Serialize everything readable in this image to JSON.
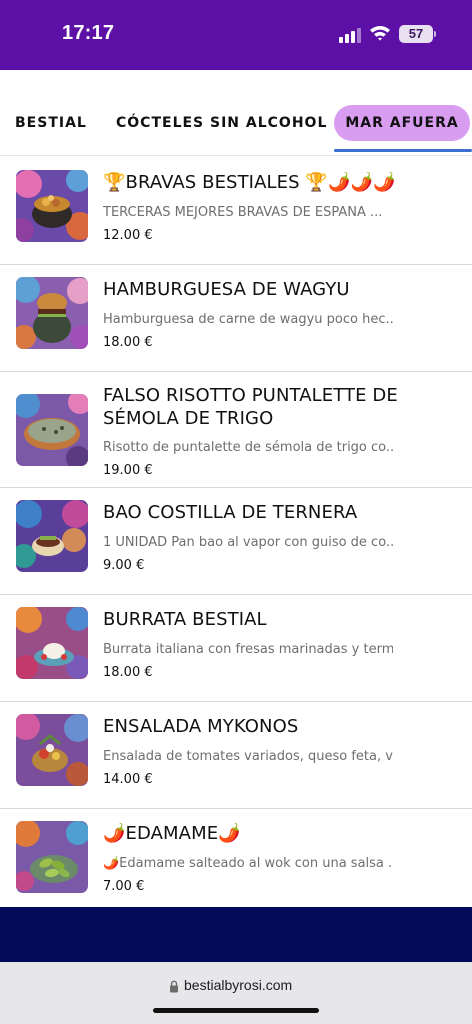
{
  "status_bar": {
    "time": "17:17",
    "battery": "57",
    "background": "#5c10a6"
  },
  "tabs": [
    {
      "label": "BESTIAL",
      "active": false
    },
    {
      "label": "CÓCTELES SIN ALCOHOL",
      "active": false
    },
    {
      "label": "MAR AFUERA",
      "active": true
    }
  ],
  "menu_items": [
    {
      "name": "🏆BRAVAS BESTIALES 🏆🌶️🌶️🌶️",
      "description": "TERCERAS MEJORES BRAVAS DE ESPAÑA ...",
      "price": "12.00 €",
      "image_icon": "bravas-photo"
    },
    {
      "name": "HAMBURGUESA DE WAGYU",
      "description": "Hamburguesa de carne de wagyu poco hec...",
      "price": "18.00 €",
      "image_icon": "burger-photo"
    },
    {
      "name": "FALSO RISOTTO PUNTALETTE DE SÉMOLA DE TRIGO",
      "description": "Risotto de puntalette de sémola de trigo co...",
      "price": "19.00 €",
      "image_icon": "risotto-photo"
    },
    {
      "name": "BAO COSTILLA DE TERNERA",
      "description": "1 UNIDAD Pan bao al vapor con guiso de co...",
      "price": "9.00 €",
      "image_icon": "bao-photo"
    },
    {
      "name": "BURRATA BESTIAL",
      "description": "Burrata italiana con fresas marinadas y term...",
      "price": "18.00 €",
      "image_icon": "burrata-photo"
    },
    {
      "name": "ENSALADA MYKONOS",
      "description": "Ensalada de tomates variados, queso feta, v...",
      "price": "14.00 €",
      "image_icon": "salad-photo"
    },
    {
      "name": "🌶️EDAMAME🌶️",
      "description": "🌶️Edamame salteado al wok con una salsa ...",
      "price": "7.00 €",
      "image_icon": "edamame-photo"
    }
  ],
  "browser": {
    "url": "bestialbyrosi.com"
  },
  "colors": {
    "active_tab": "#d89cf0",
    "tab_underline": "#3a6fd0",
    "footer_band": "#020b5a"
  }
}
